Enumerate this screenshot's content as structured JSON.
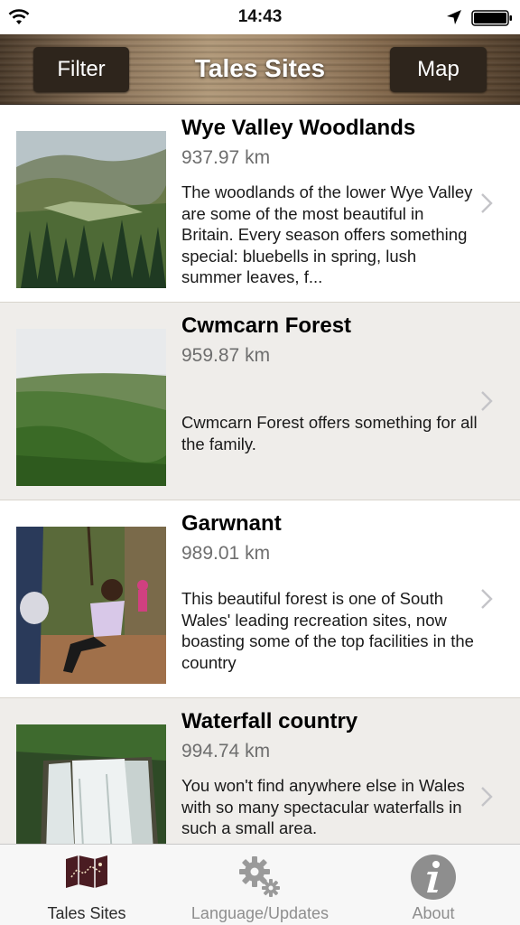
{
  "status": {
    "time": "14:43"
  },
  "nav": {
    "title": "Tales Sites",
    "filter_label": "Filter",
    "map_label": "Map"
  },
  "sites": [
    {
      "title": "Wye Valley Woodlands",
      "distance": "937.97 km",
      "description": "The woodlands of the lower Wye Valley are some of the most beautiful in Britain. Every season offers something special: bluebells in spring, lush summer leaves, f..."
    },
    {
      "title": "Cwmcarn Forest",
      "distance": "959.87 km",
      "description": "Cwmcarn Forest offers something for all the family."
    },
    {
      "title": "Garwnant",
      "distance": "989.01 km",
      "description": "This beautiful forest is one of South Wales' leading recreation sites, now boasting some of the top facilities in the country"
    },
    {
      "title": "Waterfall country",
      "distance": "994.74 km",
      "description": "You won't find anywhere else in Wales with so many spectacular waterfalls in such a small area."
    }
  ],
  "tabs": [
    {
      "label": "Tales Sites",
      "icon": "map-icon",
      "active": true
    },
    {
      "label": "Language/Updates",
      "icon": "gears-icon",
      "active": false
    },
    {
      "label": "About",
      "icon": "info-icon",
      "active": false
    }
  ]
}
